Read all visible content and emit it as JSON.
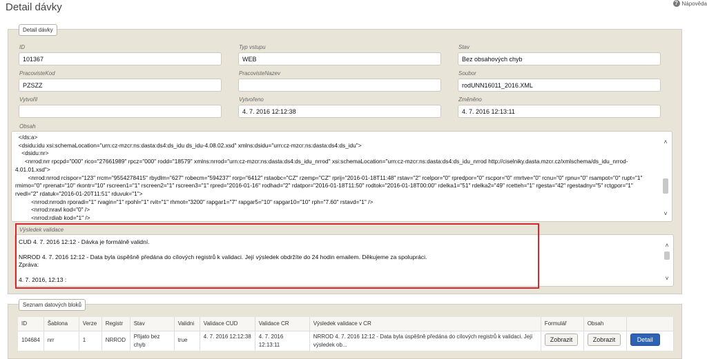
{
  "page": {
    "title": "Detail dávky",
    "help_label": "Nápověda"
  },
  "detail_panel": {
    "tab_label": "Detail dávky",
    "fields": {
      "id": {
        "label": "ID",
        "value": "101367"
      },
      "typ_vstupu": {
        "label": "Typ vstupu",
        "value": "WEB"
      },
      "stav": {
        "label": "Stav",
        "value": "Bez obsahových chyb"
      },
      "pracoviste_kod": {
        "label": "PracovisteKod",
        "value": "PZSZZ"
      },
      "pracoviste_nazev": {
        "label": "PracovisteNazev",
        "value": ""
      },
      "soubor": {
        "label": "Soubor",
        "value": "rodUNN16011_2016.XML"
      },
      "vytvoril": {
        "label": "Vytvořil",
        "value": ""
      },
      "vytvoreno": {
        "label": "Vytvořeno",
        "value": "4. 7. 2016 12:12:38"
      },
      "zmeneno": {
        "label": "Změněno",
        "value": "4. 7. 2016 12:13:11"
      }
    },
    "obsah": {
      "label": "Obsah",
      "lines": [
        "  </ds:a>",
        "  <dsidu:idu xsi:schemaLocation=\"urn:cz-mzcr:ns:dasta:ds4:ds_idu ds_idu-4.08.02.xsd\" xmlns:dsidu=\"urn:cz-mzcr:ns:dasta:ds4:ds_idu\">",
        "    <dsidu:nr>",
        "      <nrrod:nrr rpcpd=\"000\" rico=\"27661989\" rpcz=\"000\" rodd=\"18579\" xmlns:nrrod=\"urn:cz-mzcr:ns:dasta:ds4:ds_idu_nrrod\" xsi:schemaLocation=\"urn:cz-mzcr:ns:dasta:ds4:ds_idu_nrrod http://ciselniky.dasta.mzcr.cz/xmlschema/ds_idu_nrrod-4.01.01.xsd\">",
        "        <nrrod:nrrod rcispor=\"123\" rrcm=\"9554278415\" rbydlm=\"627\" robecm=\"594237\" rorp=\"6412\" rstaobc=\"CZ\" rzemp=\"CZ\" rprij=\"2016-01-18T11:48\" rstav=\"2\" rcelpor=\"0\" rpredpor=\"0\" rscpor=\"0\" rmrtve=\"0\" rcnu=\"0\" rpnu=\"0\" rsampot=\"0\" rupt=\"1\" rmimo=\"0\" rprenat=\"10\" rkontr=\"10\" rscreen1=\"1\" rscreen2=\"1\" rscreen3=\"1\" rpred=\"2016-01-16\" rodhad=\"2\" rdatpor=\"2016-01-18T11:50\" rodtok=\"2016-01-18T00:00\" rdelka1=\"51\" rdelka2=\"49\" rcetteh=\"1\" rgesta=\"42\" rgestadny=\"5\" rctgpor=\"1\" rvedl=\"2\" rdatuk=\"2016-01-20T11:51\" rduvuk=\"1\">",
        "          <nrrod:nrrodn rporadi=\"1\" rvagin=\"1\" rpohl=\"1\" rvit=\"1\" rhmot=\"3200\" rapgar1=\"7\" rapgar5=\"10\" rapgar10=\"10\" rph=\"7.60\" rstavd=\"1\" />",
        "          <nrrod:nravl kod=\"0\" />",
        "          <nrrod:rdiab kod=\"1\" />"
      ]
    },
    "vysledek_validace": {
      "label": "Výsledek validace",
      "line1": "CUD 4. 7. 2016 12:12 - Dávka je formálně validní.",
      "line2": "NRROD 4. 7. 2016 12:12 - Data byla úspěšně předána do cílových registrů k validaci. Její výsledek obdržíte do 24 hodin emailem. Děkujeme za spolupráci.",
      "line3": "Zpráva:",
      "line4": "4. 7. 2016, 12:13 :"
    }
  },
  "blocks_panel": {
    "tab_label": "Seznam datových bloků",
    "columns": [
      "ID",
      "Šablona",
      "Verze",
      "Registr",
      "Stav",
      "Validni",
      "Validace CUD",
      "Validace CR",
      "Výsledek validace v CR",
      "Formulář",
      "Obsah",
      ""
    ],
    "rows": [
      {
        "id": "104684",
        "sablona": "nrr",
        "verze": "1",
        "registr": "NRROD",
        "stav": "Přijato bez chyb",
        "validni": "true",
        "validace_cud": "4. 7. 2016 12:12:38",
        "validace_cr": "4. 7. 2016 12:13:11",
        "vysledek": "NRROD 4. 7. 2016 12:12 - Data byla úspěšně předána do cílových registrů k validaci. Její výsledek ob...",
        "formular_button": "Zobrazit",
        "obsah_button": "Zobrazit",
        "detail_button": "Detail"
      }
    ]
  },
  "colors": {
    "panel_bg": "#e8e4d8",
    "highlight": "#d8262e",
    "primary_button": "#2e63b4"
  }
}
